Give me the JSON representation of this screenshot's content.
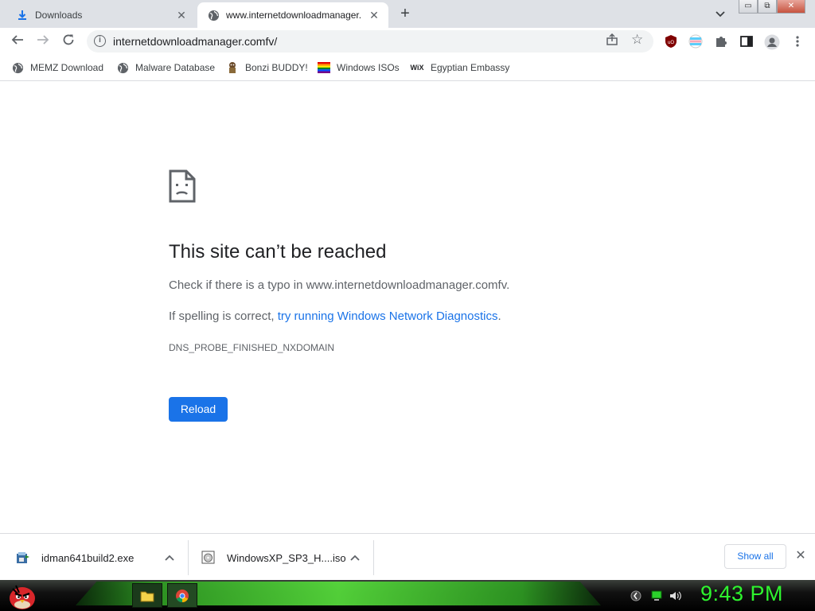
{
  "browser": {
    "tabs": [
      {
        "title": "Downloads",
        "icon": "download-icon",
        "active": false
      },
      {
        "title": "www.internetdownloadmanager.",
        "icon": "globe-icon",
        "active": true
      }
    ],
    "new_tab_symbol": "+",
    "window_buttons": {
      "minimize": "▭",
      "restore": "⧉",
      "close": "✕"
    },
    "address": "internetdownloadmanager.comfv/",
    "toolbar_icons": [
      "back-arrow-icon",
      "forward-arrow-icon",
      "reload-icon",
      "share-icon",
      "star-icon",
      "ublock-icon",
      "extension-flag-icon",
      "puzzle-icon",
      "sidepanel-icon",
      "profile-icon",
      "menu-kebab-icon"
    ]
  },
  "bookmarks": [
    {
      "label": "MEMZ Download",
      "icon": "globe-icon"
    },
    {
      "label": "Malware Database",
      "icon": "globe-icon"
    },
    {
      "label": "Bonzi BUDDY!",
      "icon": "bonzi-icon"
    },
    {
      "label": "Windows ISOs",
      "icon": "rainbow-flag-icon"
    },
    {
      "label": "Egyptian Embassy",
      "icon": "wix-icon",
      "icon_text": "WiX"
    }
  ],
  "error_page": {
    "title": "This site can’t be reached",
    "line1": "Check if there is a typo in www.internetdownloadmanager.comfv.",
    "line2_prefix": "If spelling is correct, ",
    "line2_link": "try running Windows Network Diagnostics",
    "line2_suffix": ".",
    "error_code": "DNS_PROBE_FINISHED_NXDOMAIN",
    "reload_label": "Reload"
  },
  "downloads": [
    {
      "name": "idman641build2.exe",
      "icon": "installer-icon"
    },
    {
      "name": "WindowsXP_SP3_H....iso",
      "icon": "iso-disc-icon"
    }
  ],
  "shelf": {
    "show_all_label": "Show all",
    "close_symbol": "✕"
  },
  "taskbar": {
    "clock": "9:43 PM",
    "apps": [
      "folder-icon",
      "chrome-icon"
    ]
  },
  "colors": {
    "accent": "#1a73e8",
    "tabstrip": "#dee1e6",
    "clock": "#2ef52e"
  }
}
